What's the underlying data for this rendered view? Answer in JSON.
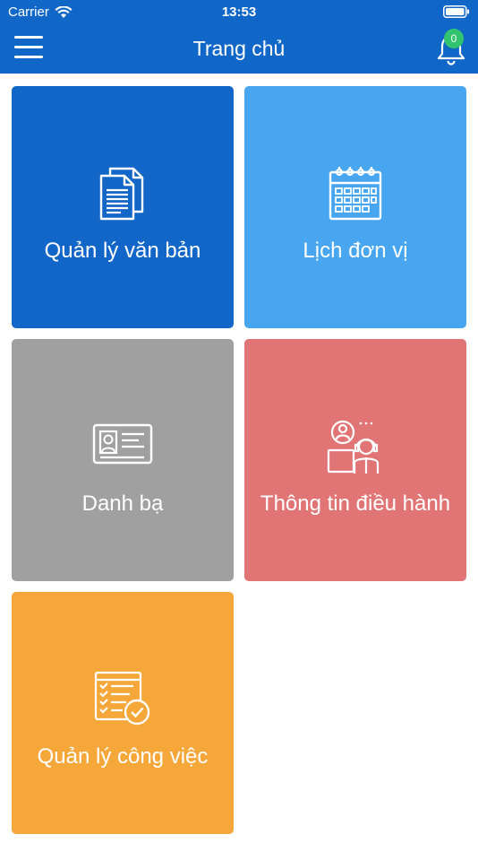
{
  "status_bar": {
    "carrier": "Carrier",
    "time": "13:53"
  },
  "header": {
    "title": "Trang chủ",
    "notification_count": "0"
  },
  "tiles": [
    {
      "label": "Quản lý văn bản",
      "icon": "documents-icon",
      "color": "#1266c8"
    },
    {
      "label": "Lịch đơn vị",
      "icon": "calendar-icon",
      "color": "#48a6f1"
    },
    {
      "label": "Danh bạ",
      "icon": "contact-card-icon",
      "color": "#a0a0a0"
    },
    {
      "label": "Thông tin điều hành",
      "icon": "support-agents-icon",
      "color": "#e17576"
    },
    {
      "label": "Quản lý công việc",
      "icon": "task-list-icon",
      "color": "#f6a73a"
    }
  ]
}
